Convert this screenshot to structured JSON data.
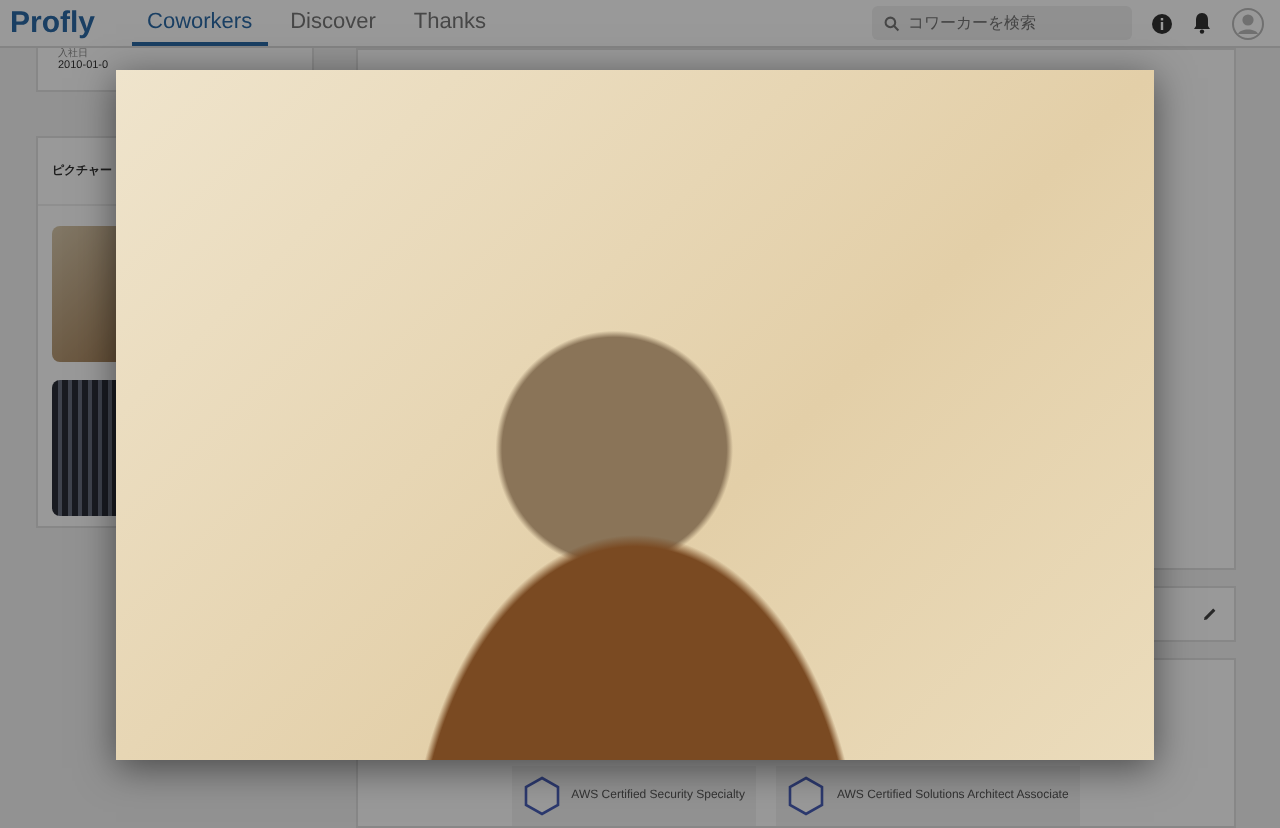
{
  "header": {
    "logo": "Profly",
    "tabs": [
      {
        "label": "Coworkers",
        "selected": true
      },
      {
        "label": "Discover",
        "selected": false
      },
      {
        "label": "Thanks",
        "selected": false
      }
    ],
    "search": {
      "placeholder": "コワーカーを検索"
    }
  },
  "profile_card": {
    "label": "入社日",
    "value": "2010-01-0"
  },
  "pictures_card": {
    "title": "ピクチャー"
  },
  "certifications": [
    {
      "name": "AWS Certified Security Specialty"
    },
    {
      "name": "AWS Certified Solutions Architect Associate"
    }
  ]
}
